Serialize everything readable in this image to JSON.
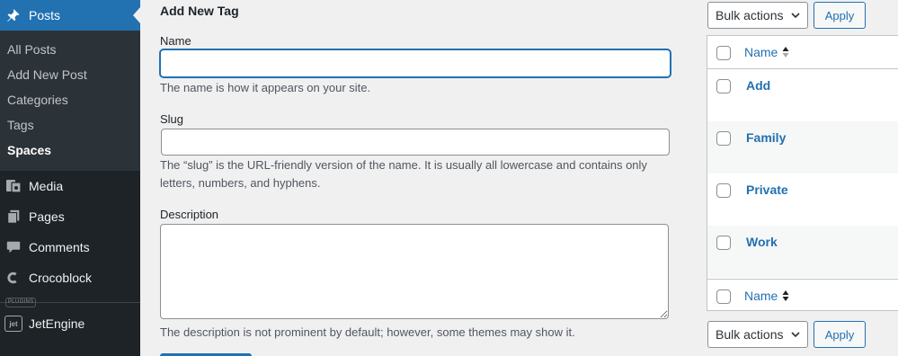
{
  "sidebar": {
    "posts": {
      "label": "Posts",
      "icon": "pushpin-icon"
    },
    "submenu": [
      "All Posts",
      "Add New Post",
      "Categories",
      "Tags",
      "Spaces"
    ],
    "media": {
      "label": "Media",
      "icon": "media-icon"
    },
    "pages": {
      "label": "Pages",
      "icon": "pages-icon"
    },
    "comments": {
      "label": "Comments",
      "icon": "comments-icon"
    },
    "crocoblock": {
      "label": "Crocoblock",
      "icon": "crocoblock-icon"
    },
    "plugins_label": "PLUGINS",
    "jetengine": {
      "label": "JetEngine",
      "icon_text": "jet"
    }
  },
  "form": {
    "heading": "Add New Tag",
    "name_label": "Name",
    "name_value": "",
    "name_help": "The name is how it appears on your site.",
    "slug_label": "Slug",
    "slug_value": "",
    "slug_help": "The “slug” is the URL-friendly version of the name. It is usually all lowercase and contains only letters, numbers, and hyphens.",
    "description_label": "Description",
    "description_value": "",
    "description_help": "The description is not prominent by default; however, some themes may show it."
  },
  "table": {
    "bulk_actions_label": "Bulk actions",
    "apply_label": "Apply",
    "column_name": "Name",
    "rows": [
      "Add",
      "Family",
      "Private",
      "Work"
    ]
  },
  "colors": {
    "accent": "#2271b1",
    "sidebar_bg": "#1d2327",
    "submenu_bg": "#2c3338",
    "page_bg": "#f0f0f1"
  }
}
